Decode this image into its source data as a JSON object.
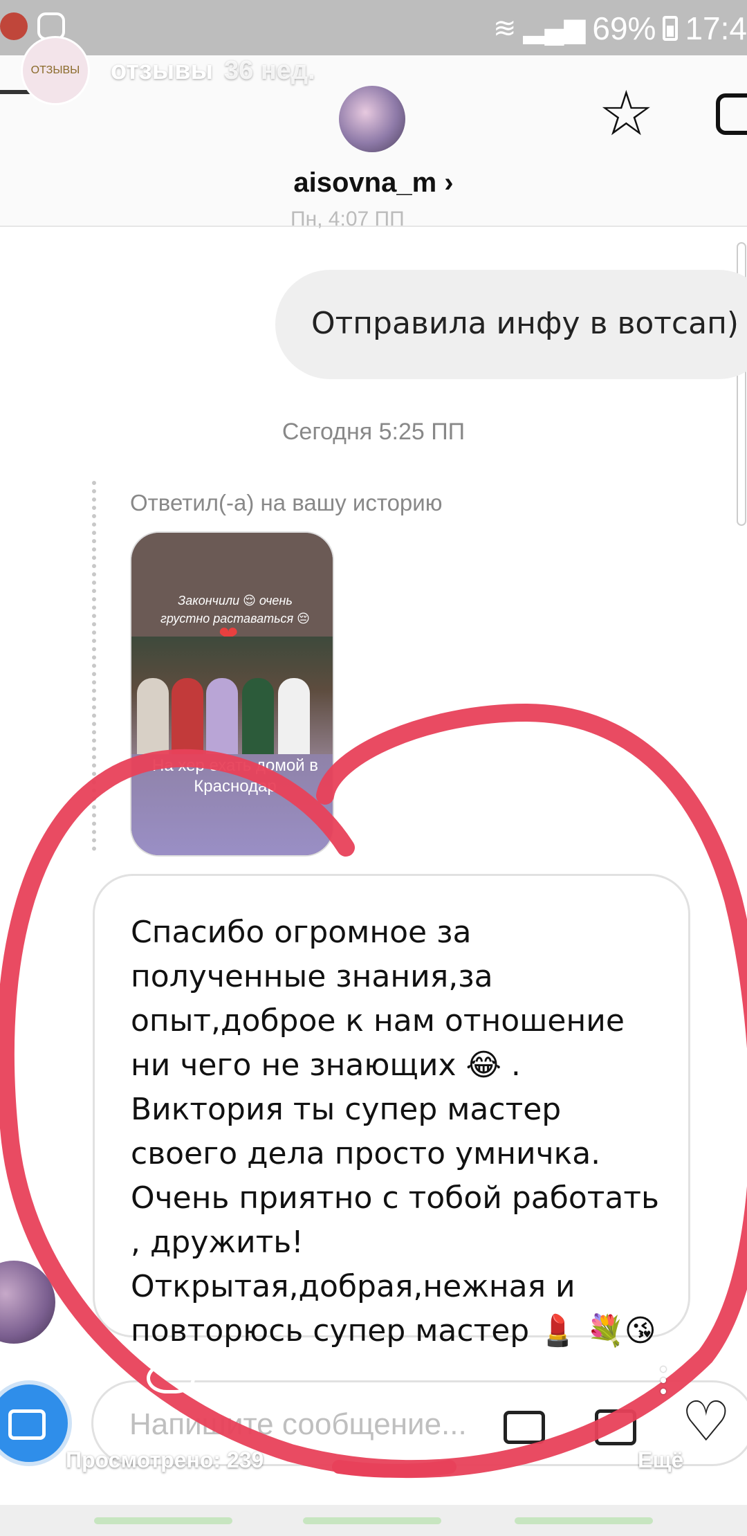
{
  "status_bar": {
    "battery": "69%",
    "time": "17:4"
  },
  "story": {
    "account": "отзывы",
    "avatar_label": "ОТЗЫВЫ",
    "age": "36 нед.",
    "views": "Просмотрено: 239",
    "more": "Ещё"
  },
  "chat": {
    "username": "aisovna_m",
    "chevron": "›"
  },
  "thread": {
    "cut_timestamp": "Пн, 4:07 ПП",
    "sent_message": "Отправила инфу в вотсап)",
    "timestamp": "Сегодня 5:25 ПП",
    "reply_label": "Ответил(-а) на вашу историю",
    "story_caption": "Закончили 😌 очень грустно раставаться 😔",
    "story_caption2": "На хер ехать домой в Краснодар",
    "received_message": "Спасибо огромное за полученные знания,за опыт,доброе к нам отношение ни чего не знающих 😂 . Виктория ты супер мастер своего дела просто умничка. Очень приятно с тобой работать , дружить! Открытая,добрая,нежная и повторюсь супер мастер 💄 💐😘"
  },
  "composer": {
    "placeholder": "Напишите сообщение..."
  },
  "colors": {
    "annotation": "#e8415a",
    "accent": "#2f8eea"
  }
}
